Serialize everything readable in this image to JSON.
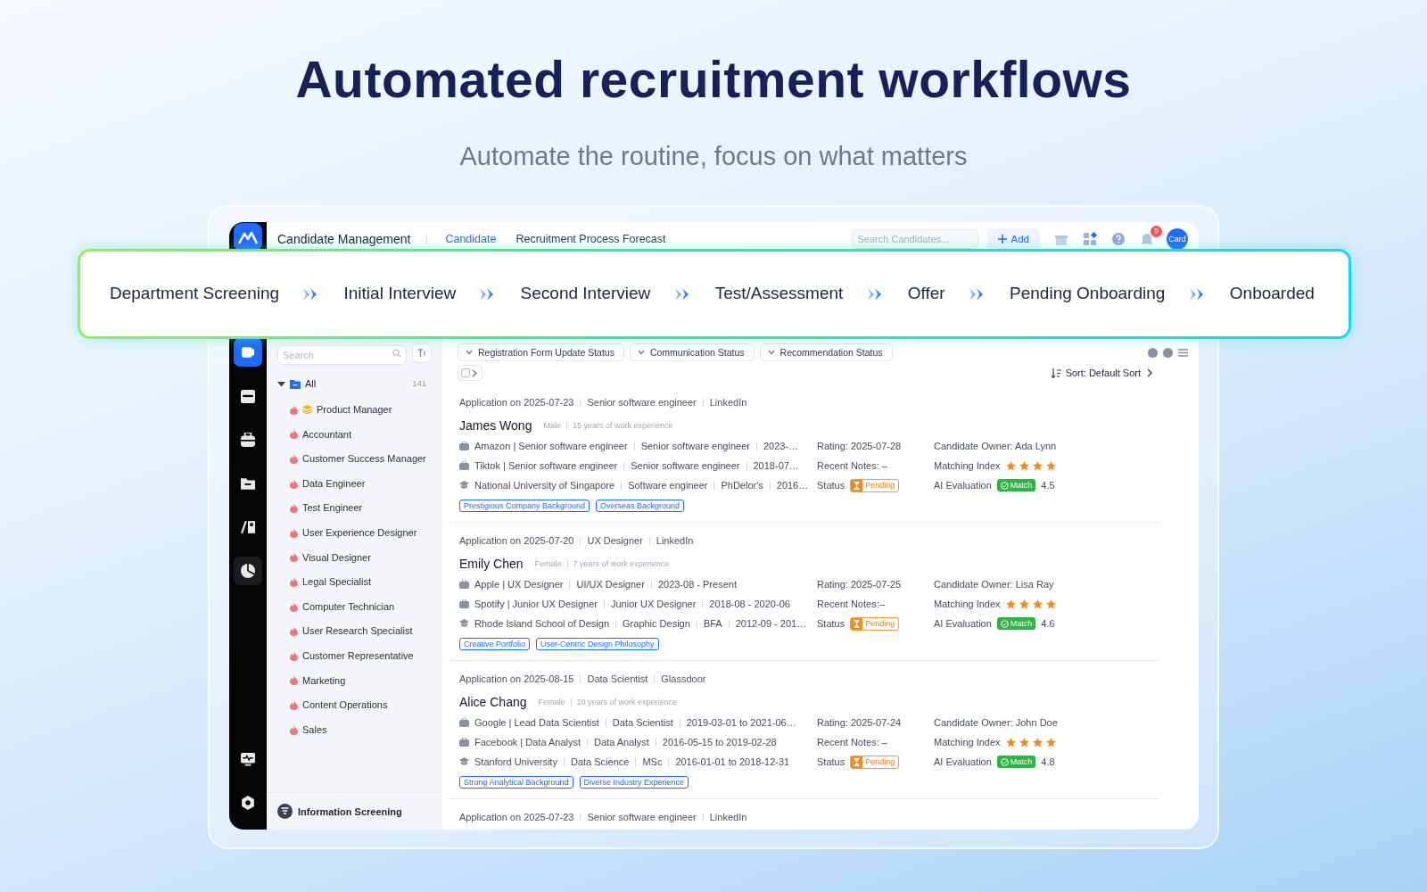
{
  "headline": "Automated recruitment workflows",
  "subheadline": "Automate the routine, focus on what matters",
  "app": {
    "header": {
      "title": "Candidate Management",
      "tabs": [
        {
          "label": "Candidate",
          "selected": true
        },
        {
          "label": "Recruitment Process Forecast",
          "selected": false
        }
      ],
      "search": {
        "placeholder": "Search Candidates..."
      },
      "add_button": "Add",
      "notification_count": "9",
      "avatar": "Card"
    },
    "rail": [
      {
        "selected": true
      },
      {
        "selected": false
      },
      {
        "selected": false
      },
      {
        "selected": false
      },
      {
        "selected": false
      },
      {
        "selected": false
      },
      {
        "selected": false
      },
      {
        "selected": false
      }
    ],
    "sidebar": {
      "search": {
        "placeholder": "Search"
      },
      "root": {
        "label": "All",
        "count": "141",
        "expanded": true,
        "children": [
          {
            "label": "Product Manager",
            "kind": "featured"
          },
          {
            "label": "Accountant",
            "kind": "position"
          },
          {
            "label": "Customer Success Manager",
            "kind": "position"
          },
          {
            "label": "Data Engineer",
            "kind": "position"
          },
          {
            "label": "Test Engineer",
            "kind": "position"
          },
          {
            "label": "User Experience Designer",
            "kind": "position"
          },
          {
            "label": "Visual Designer",
            "kind": "position"
          },
          {
            "label": "Legal Specialist",
            "kind": "position"
          },
          {
            "label": "Computer Technician",
            "kind": "position"
          },
          {
            "label": "User Research Specialist",
            "kind": "position"
          },
          {
            "label": "Customer Representative",
            "kind": "position"
          },
          {
            "label": "Marketing",
            "kind": "position"
          },
          {
            "label": "Content Operations",
            "kind": "position"
          },
          {
            "label": "Sales",
            "kind": "position"
          }
        ]
      },
      "footer": "Information Screening"
    },
    "filters": [
      "Registration Form Update Status",
      "Communication Status",
      "Recommendation Status"
    ],
    "list_toolbar": {
      "select_all": {
        "checked": false
      },
      "sort": "Sort: Default Sort"
    },
    "candidates": [
      {
        "application": [
          "Application on 2025-07-23",
          "Senior software engineer",
          "LinkedIn"
        ],
        "name": "James Wong",
        "gender": "Male",
        "experience": "15 years of work experience",
        "history": [
          {
            "kind": "work",
            "parts": [
              "Amazon | Senior software engineer",
              "Senior software engineer",
              "2023-…"
            ]
          },
          {
            "kind": "work",
            "parts": [
              "Tiktok | Senior software engineer",
              "Senior software engineer",
              "2018-07…"
            ]
          },
          {
            "kind": "education",
            "parts": [
              "National University of Singapore",
              "Software engineer",
              "PhDelor's",
              "2016…"
            ]
          }
        ],
        "rating": "Rating: 2025-07-28",
        "notes": "Recent Notes: –",
        "status_label": "Status",
        "status": "Pending",
        "owner": "Candidate Owner: Ada Lynn",
        "matching_label": "Matching Index",
        "stars": 4,
        "ai_label": "AI Evaluation",
        "ai_result": "Match",
        "score": "4.5",
        "tags": [
          "Prestigious Company Background",
          "Overseas Background"
        ]
      },
      {
        "application": [
          "Application on 2025-07-20",
          "UX Designer",
          "LinkedIn"
        ],
        "name": "Emily Chen",
        "gender": "Female",
        "experience": "7 years of work experience",
        "history": [
          {
            "kind": "work",
            "parts": [
              "Apple | UX Designer",
              "UI/UX Designer",
              "2023-08 -  Present"
            ]
          },
          {
            "kind": "work",
            "parts": [
              "Spotify | Junior UX Designer",
              "Junior UX Designer",
              "2018-08 - 2020-06"
            ]
          },
          {
            "kind": "education",
            "parts": [
              "Rhode Island School of Design",
              "Graphic Design",
              "BFA",
              "2012-09 - 201…"
            ]
          }
        ],
        "rating": "Rating: 2025-07-25",
        "notes": "Recent Notes:–",
        "status_label": "Status",
        "status": "Pending",
        "owner": "Candidate Owner: Lisa Ray",
        "matching_label": "Matching Index",
        "stars": 4,
        "ai_label": "AI Evaluation",
        "ai_result": "Match",
        "score": "4.6",
        "tags": [
          "Creative Portfolio",
          "User-Centric Design Philosophy"
        ]
      },
      {
        "application": [
          "Application on 2025-08-15",
          "Data Scientist",
          "Glassdoor"
        ],
        "name": "Alice Chang",
        "gender": "Female",
        "experience": "10 years of work experience",
        "history": [
          {
            "kind": "work",
            "parts": [
              "Google | Lead Data Scientist",
              "Data Scientist",
              "2019-03-01 to 2021-06…"
            ]
          },
          {
            "kind": "work",
            "parts": [
              "Facebook | Data Analyst",
              "Data Analyst",
              "2016-05-15 to 2019-02-28"
            ]
          },
          {
            "kind": "education",
            "parts": [
              "Stanford University",
              "Data Science",
              "MSc",
              "2016-01-01 to 2018-12-31"
            ]
          }
        ],
        "rating": "Rating: 2025-07-24",
        "notes": "Recent Notes: –",
        "status_label": "Status",
        "status": "Pending",
        "owner": "Candidate Owner: John Doe",
        "matching_label": "Matching Index",
        "stars": 4,
        "ai_label": "AI Evaluation",
        "ai_result": "Match",
        "score": "4.8",
        "tags": [
          "Strong Analytical Background",
          "Diverse Industry Experience"
        ]
      }
    ],
    "next_candidate": {
      "application": [
        "Application on 2025-07-23",
        "Senior software engineer",
        "LinkedIn"
      ]
    }
  },
  "workflow": {
    "stages": [
      "Department Screening",
      "Initial Interview",
      "Second Interview",
      "Test/Assessment",
      "Offer",
      "Pending Onboarding",
      "Onboarded"
    ]
  }
}
